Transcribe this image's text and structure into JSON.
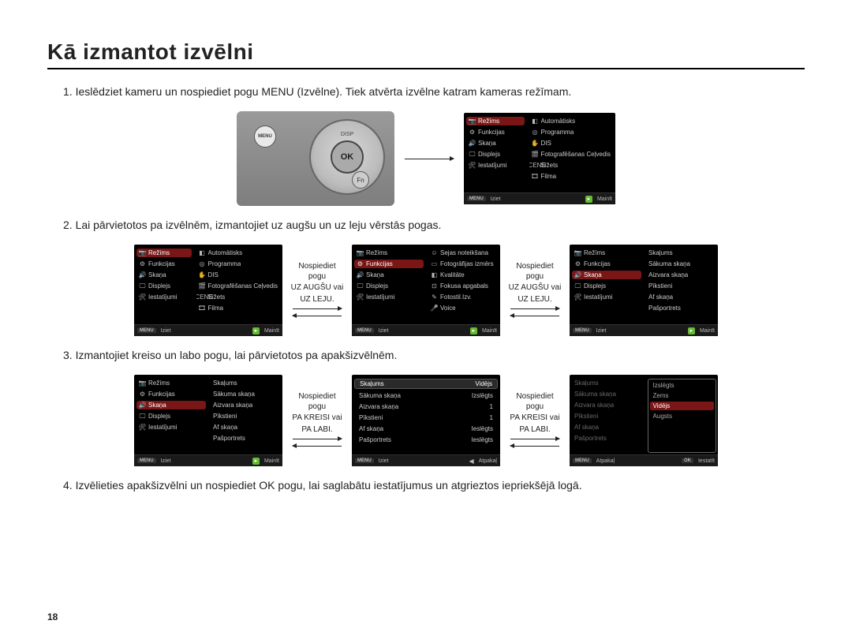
{
  "title": "Kā izmantot izvēlni",
  "page_number": "18",
  "steps": {
    "s1": "1. Ieslēdziet kameru un nospiediet pogu MENU (Izvēlne). Tiek atvērta izvēlne katram kameras režīmam.",
    "s2": "2. Lai pārvietotos pa izvēlnēm, izmantojiet uz augšu un uz leju vērstās pogas.",
    "s3": "3. Izmantojiet kreiso un labo pogu, lai pārvietotos pa apakšizvēlnēm.",
    "s4": "4. Izvēlieties apakšizvēlni un nospiediet OK pogu, lai saglabātu iestatījumus un atgrieztos iepriekšējā logā."
  },
  "arrow_labels": {
    "updown": {
      "l1": "Nospiediet pogu",
      "l2": "UZ AUGŠU vai",
      "l3": "UZ LEJU."
    },
    "leftright": {
      "l1": "Nospiediet pogu",
      "l2": "PA KREISI vai",
      "l3": "PA LABI."
    }
  },
  "camera": {
    "menu": "MENU",
    "ok": "OK",
    "disp": "DISP",
    "fn": "Fn"
  },
  "menu_main": {
    "left": [
      {
        "ico": "📷",
        "label": "Režīms",
        "sel": true
      },
      {
        "ico": "⚙",
        "label": "Funkcijas"
      },
      {
        "ico": "🔊",
        "label": "Skaņa"
      },
      {
        "ico": "🖵",
        "label": "Displejs"
      },
      {
        "ico": "🛠",
        "label": "Iestatījumi"
      }
    ],
    "right": [
      {
        "ico": "◧",
        "label": "Automātisks"
      },
      {
        "ico": "◎",
        "label": "Programma"
      },
      {
        "ico": "✋",
        "label": "DIS"
      },
      {
        "ico": "🎬",
        "label": "Fotografēšanas Ceļvedis"
      },
      {
        "ico": "SCENE",
        "label": "Sižets"
      },
      {
        "ico": "🎞",
        "label": "Filma"
      }
    ]
  },
  "menu_func": {
    "left": [
      {
        "ico": "📷",
        "label": "Režīms"
      },
      {
        "ico": "⚙",
        "label": "Funkcijas",
        "sel": true
      },
      {
        "ico": "🔊",
        "label": "Skaņa"
      },
      {
        "ico": "🖵",
        "label": "Displejs"
      },
      {
        "ico": "🛠",
        "label": "Iestatījumi"
      }
    ],
    "right": [
      {
        "ico": "☺",
        "label": "Sejas noteikšana"
      },
      {
        "ico": "▭",
        "label": "Fotogrāfijas izmērs"
      },
      {
        "ico": "◧",
        "label": "Kvalitāte"
      },
      {
        "ico": "⊡",
        "label": "Fokusa apgabals"
      },
      {
        "ico": "✎",
        "label": "Fotostil.Izv."
      },
      {
        "ico": "🎤",
        "label": "Voice"
      }
    ]
  },
  "menu_sound": {
    "left": [
      {
        "ico": "📷",
        "label": "Režīms"
      },
      {
        "ico": "⚙",
        "label": "Funkcijas"
      },
      {
        "ico": "🔊",
        "label": "Skaņa",
        "sel": true
      },
      {
        "ico": "🖵",
        "label": "Displejs"
      },
      {
        "ico": "🛠",
        "label": "Iestatījumi"
      }
    ],
    "right": [
      {
        "label": "Skaļums"
      },
      {
        "label": "Sākuma skaņa"
      },
      {
        "label": "Aizvara skaņa"
      },
      {
        "label": "Pīkstieni"
      },
      {
        "label": "Af skaņa"
      },
      {
        "label": "Pašportrets"
      }
    ]
  },
  "menu_sound_vals": {
    "left": [
      {
        "label": "Skaļums",
        "val": "Vidējs",
        "sel": true
      },
      {
        "label": "Sākuma skaņa",
        "val": "Izslēgts"
      },
      {
        "label": "Aizvara skaņa",
        "val": "1"
      },
      {
        "label": "Pīkstieni",
        "val": "1"
      },
      {
        "label": "Af skaņa",
        "val": "Ieslēgts"
      },
      {
        "label": "Pašportrets",
        "val": "Ieslēgts"
      }
    ]
  },
  "menu_sound_opts": {
    "left_dim": [
      {
        "label": "Skaļums"
      },
      {
        "label": "Sākuma skaņa"
      },
      {
        "label": "Aizvara skaņa"
      },
      {
        "label": "Pīkstieni"
      },
      {
        "label": "Af skaņa"
      },
      {
        "label": "Pašportrets"
      }
    ],
    "options": [
      {
        "label": "Izslēgts"
      },
      {
        "label": "Zems"
      },
      {
        "label": "Vidējs",
        "sel": true
      },
      {
        "label": "Augsts"
      }
    ]
  },
  "footer": {
    "menu_tag": "MENU",
    "exit": "Iziet",
    "change": "Mainīt",
    "back": "Atpakaļ",
    "ok_tag": "OK",
    "set": "Iestatīt"
  }
}
